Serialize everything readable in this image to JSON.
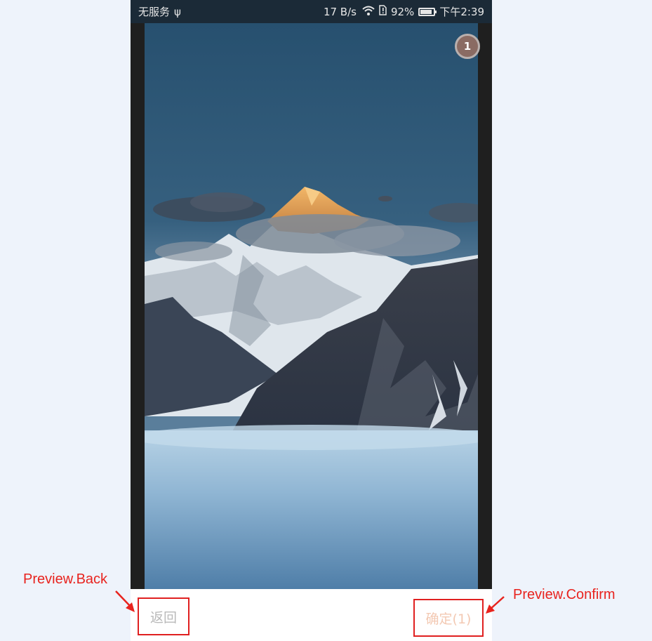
{
  "status_bar": {
    "carrier": "无服务",
    "usb_symbol": "ψ",
    "network_speed": "17 B/s",
    "battery_percent": "92%",
    "time": "下午2:39"
  },
  "preview": {
    "selected_count": "1",
    "back_label": "返回",
    "confirm_label": "确定(1)"
  },
  "annotations": {
    "back": "Preview.Back",
    "confirm": "Preview.Confirm"
  },
  "colors": {
    "annotation": "#e8231e",
    "confirm_text": "#f3c9b3",
    "back_text": "#b9b9b9"
  }
}
